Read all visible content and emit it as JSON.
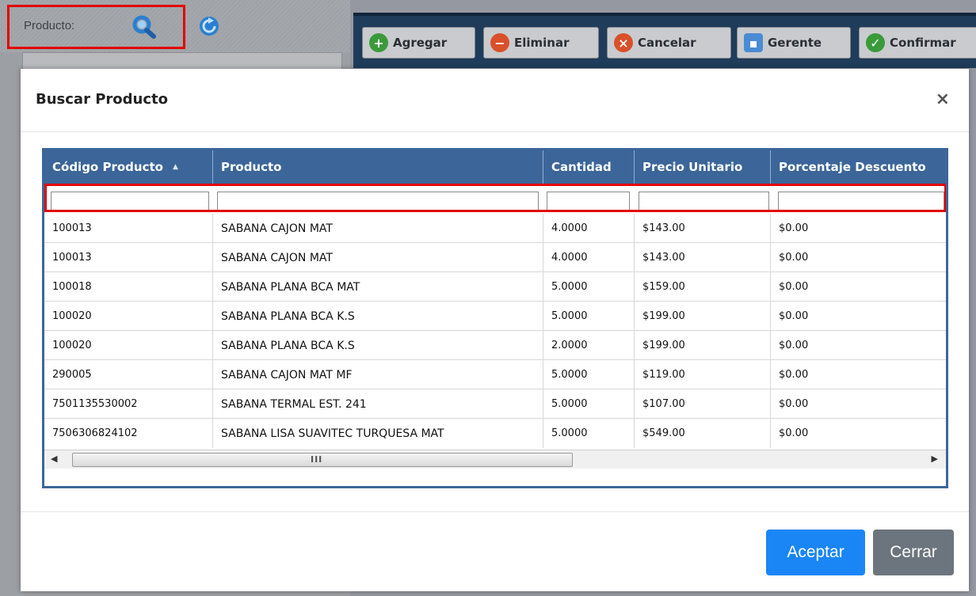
{
  "background": {
    "producto_label": "Producto:",
    "toolbar": [
      {
        "label": "Agregar",
        "icon": "plus-circle-icon",
        "color": "#3a9a3a"
      },
      {
        "label": "Eliminar",
        "icon": "minus-circle-icon",
        "color": "#d9502b"
      },
      {
        "label": "Cancelar",
        "icon": "x-circle-icon",
        "color": "#d9502b"
      },
      {
        "label": "Gerente",
        "icon": "manager-icon",
        "color": "#4a8bd4"
      },
      {
        "label": "Confirmar",
        "icon": "check-circle-icon",
        "color": "#3a9a3a"
      }
    ]
  },
  "modal": {
    "title": "Buscar Producto",
    "close_icon": "×",
    "columns": [
      "Código Producto",
      "Producto",
      "Cantidad",
      "Precio Unitario",
      "Porcentaje Descuento"
    ],
    "sort_indicator": "▲",
    "filters": [
      "",
      "",
      "",
      "",
      ""
    ],
    "rows": [
      [
        "100013",
        "SABANA CAJON MAT",
        "4.0000",
        "$143.00",
        "$0.00"
      ],
      [
        "100013",
        "SABANA CAJON MAT",
        "4.0000",
        "$143.00",
        "$0.00"
      ],
      [
        "100018",
        "SABANA PLANA BCA MAT",
        "5.0000",
        "$159.00",
        "$0.00"
      ],
      [
        "100020",
        "SABANA PLANA BCA K.S",
        "5.0000",
        "$199.00",
        "$0.00"
      ],
      [
        "100020",
        "SABANA PLANA BCA K.S",
        "2.0000",
        "$199.00",
        "$0.00"
      ],
      [
        "290005",
        "SABANA CAJON MAT MF",
        "5.0000",
        "$119.00",
        "$0.00"
      ],
      [
        "7501135530002",
        "SABANA TERMAL EST. 241",
        "5.0000",
        "$107.00",
        "$0.00"
      ],
      [
        "7506306824102",
        "SABANA LISA SUAVITEC TURQUESA MAT",
        "5.0000",
        "$549.00",
        "$0.00"
      ]
    ],
    "scroll_left": "◀",
    "scroll_right": "▶",
    "scroll_grip": "III",
    "accept_label": "Aceptar",
    "close_label": "Cerrar"
  },
  "colors": {
    "header_blue": "#3c6699",
    "highlight_red": "#e30000",
    "accept_blue": "#1a86f5",
    "close_gray": "#6c757d"
  }
}
